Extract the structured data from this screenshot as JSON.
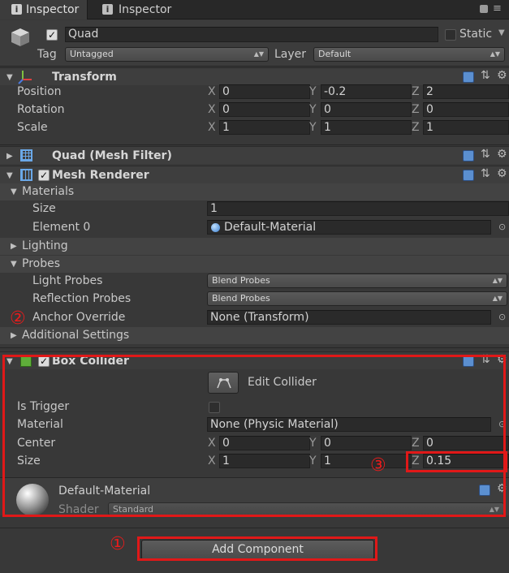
{
  "tabs": [
    {
      "label": "Inspector"
    },
    {
      "label": "Inspector"
    }
  ],
  "object": {
    "name": "Quad",
    "static_label": "Static",
    "tag_label": "Tag",
    "tag_value": "Untagged",
    "layer_label": "Layer",
    "layer_value": "Default"
  },
  "transform": {
    "title": "Transform",
    "rows": [
      {
        "label": "Position",
        "x": "0",
        "y": "-0.2",
        "z": "2"
      },
      {
        "label": "Rotation",
        "x": "0",
        "y": "0",
        "z": "0"
      },
      {
        "label": "Scale",
        "x": "1",
        "y": "1",
        "z": "1"
      }
    ]
  },
  "axes": {
    "x": "X",
    "y": "Y",
    "z": "Z"
  },
  "mesh_filter": {
    "title": "Quad (Mesh Filter)"
  },
  "mesh_renderer": {
    "title": "Mesh Renderer",
    "materials_label": "Materials",
    "size_label": "Size",
    "size_value": "1",
    "element0_label": "Element 0",
    "element0_value": "Default-Material",
    "lighting_label": "Lighting",
    "probes_label": "Probes",
    "light_probes_label": "Light Probes",
    "light_probes_value": "Blend Probes",
    "reflection_probes_label": "Reflection Probes",
    "reflection_probes_value": "Blend Probes",
    "anchor_label": "Anchor Override",
    "anchor_value": "None (Transform)",
    "additional_label": "Additional Settings"
  },
  "box_collider": {
    "title": "Box Collider",
    "edit_collider": "Edit Collider",
    "is_trigger_label": "Is Trigger",
    "material_label": "Material",
    "material_value": "None (Physic Material)",
    "center_label": "Center",
    "center": {
      "x": "0",
      "y": "0",
      "z": "0"
    },
    "size_label": "Size",
    "size": {
      "x": "1",
      "y": "1",
      "z": "0.15"
    }
  },
  "material": {
    "name": "Default-Material",
    "shader_label": "Shader",
    "shader_value": "Standard"
  },
  "add_component": "Add Component",
  "annotations": {
    "one": "①",
    "two": "②",
    "three": "③"
  },
  "colors": {
    "annotation": "#e01818",
    "background": "#383838"
  }
}
